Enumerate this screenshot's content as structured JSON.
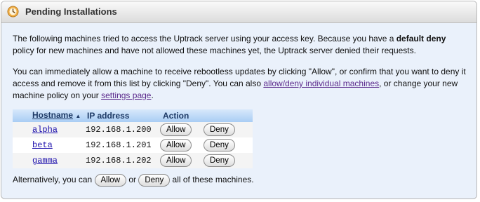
{
  "panel": {
    "title": "Pending Installations"
  },
  "intro": {
    "line_pre": "The following machines tried to access the Uptrack server using your access key. Because you have a ",
    "bold": "default deny",
    "line_post": " policy for new machines and have not allowed these machines yet, the Uptrack server denied their requests."
  },
  "instructions": {
    "text1": "You can immediately allow a machine to receive rebootless updates by clicking \"Allow\", or confirm that you want to deny it access and remove it from this list by clicking \"Deny\". You can also ",
    "link1": "allow/deny individual machines",
    "text2": ", or change your new machine policy on your ",
    "link2": "settings page",
    "text3": "."
  },
  "table": {
    "col_hostname": "Hostname",
    "sort_indicator": "▲",
    "col_ip": "IP address",
    "col_action": "Action",
    "rows": [
      {
        "hostname": "alpha",
        "ip": "192.168.1.200",
        "allow": "Allow",
        "deny": "Deny"
      },
      {
        "hostname": "beta",
        "ip": "192.168.1.201",
        "allow": "Allow",
        "deny": "Deny"
      },
      {
        "hostname": "gamma",
        "ip": "192.168.1.202",
        "allow": "Allow",
        "deny": "Deny"
      }
    ]
  },
  "footer": {
    "pre": "Alternatively, you can ",
    "allow": "Allow",
    "mid": " or ",
    "deny": "Deny",
    "post": " all of these machines."
  }
}
